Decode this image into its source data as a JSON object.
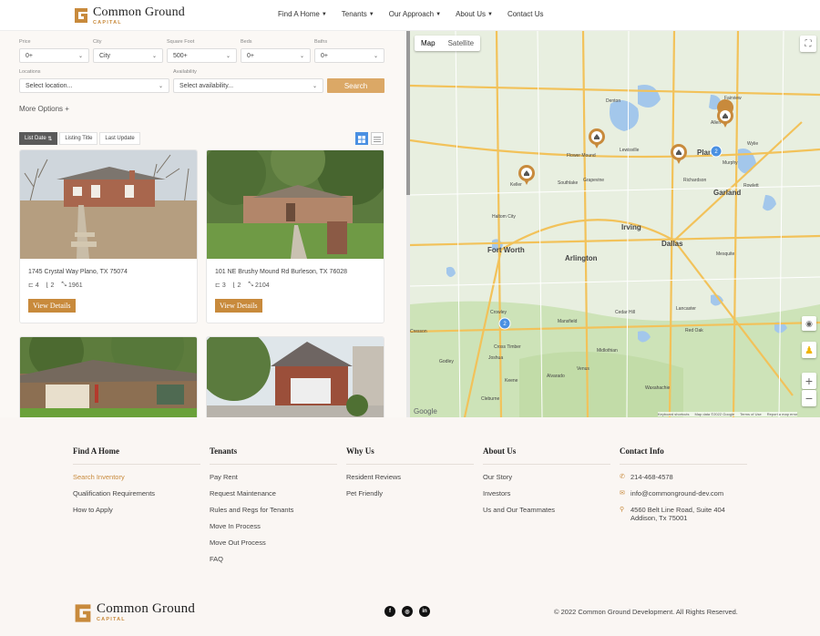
{
  "brand": {
    "name": "Common Ground",
    "sub": "CAPITAL"
  },
  "nav": [
    {
      "label": "Find A Home",
      "dropdown": true
    },
    {
      "label": "Tenants",
      "dropdown": true
    },
    {
      "label": "Our Approach",
      "dropdown": true
    },
    {
      "label": "About Us",
      "dropdown": true
    },
    {
      "label": "Contact Us",
      "dropdown": false
    }
  ],
  "filters": {
    "price": {
      "label": "Price",
      "value": "0+"
    },
    "city": {
      "label": "City",
      "value": "City"
    },
    "sqft": {
      "label": "Square Foot",
      "value": "500+"
    },
    "beds": {
      "label": "Beds",
      "value": "0+"
    },
    "baths": {
      "label": "Baths",
      "value": "0+"
    },
    "location": {
      "label": "Locations",
      "value": "Select location..."
    },
    "availability": {
      "label": "Availability",
      "value": "Select availability..."
    },
    "search_label": "Search",
    "more_options": "More Options +"
  },
  "sort": {
    "tabs": [
      "List Date",
      "Listing Title",
      "Last Update"
    ],
    "active": "List Date"
  },
  "listings": [
    {
      "address": "1745 Crystal Way Plano, TX 75074",
      "beds": "4",
      "baths": "2",
      "sqft": "1961",
      "button": "View Details"
    },
    {
      "address": "101 NE Brushy Mound Rd Burleson, TX 76028",
      "beds": "3",
      "baths": "2",
      "sqft": "2104",
      "button": "View Details"
    },
    {
      "address": "",
      "beds": "",
      "baths": "",
      "sqft": "",
      "button": ""
    },
    {
      "address": "",
      "beds": "",
      "baths": "",
      "sqft": "",
      "button": ""
    }
  ],
  "map": {
    "types": [
      "Map",
      "Satellite"
    ],
    "active_type": "Map",
    "cities": [
      "Denton",
      "Lewisville",
      "Flower Mound",
      "Plano",
      "Allen",
      "Fairview",
      "Murphy",
      "Garland",
      "Richardson",
      "Keller",
      "Southlake",
      "Grapevine",
      "Irving",
      "Fort Worth",
      "Arlington",
      "Dallas",
      "Haltom City",
      "Mansfield",
      "Cedar Hill",
      "Lancaster",
      "Red Oak",
      "Midlothian",
      "Waxahachie",
      "Crowley",
      "Cleburne",
      "Joshua",
      "Cross Timber",
      "Alvarado",
      "Keene",
      "Venus",
      "Godley",
      "Cresson",
      "Mesquite",
      "Rowlett",
      "Wylie"
    ],
    "cluster_counts": [
      "2",
      "2"
    ],
    "footer_notes": [
      "Keyboard shortcuts",
      "Map data ©2022 Google",
      "Terms of Use",
      "Report a map error"
    ],
    "google": "Google",
    "water_color": "#a3c7eb",
    "land_color": "#e8efe0",
    "park_color": "#c8e2b3",
    "road_color": "#f2c25a"
  },
  "footer": {
    "columns": [
      {
        "title": "Find A Home",
        "links": [
          "Search Inventory",
          "Qualification Requirements",
          "How to Apply"
        ]
      },
      {
        "title": "Tenants",
        "links": [
          "Pay Rent",
          "Request Maintenance",
          "Rules and Regs for Tenants",
          "Move In Process",
          "Move Out Process",
          "FAQ"
        ]
      },
      {
        "title": "Why Us",
        "links": [
          "Resident Reviews",
          "Pet Friendly"
        ]
      },
      {
        "title": "About Us",
        "links": [
          "Our Story",
          "Investors",
          "Us and Our Teammates"
        ]
      }
    ],
    "contact": {
      "title": "Contact Info",
      "phone": "214-468-4578",
      "email": "info@commonground-dev.com",
      "address1": "4560 Belt Line Road, Suite 404",
      "address2": "Addison, Tx 75001"
    },
    "copyright": "© 2022 Common Ground Development. All Rights Reserved.",
    "accent": "#c88a3c"
  }
}
